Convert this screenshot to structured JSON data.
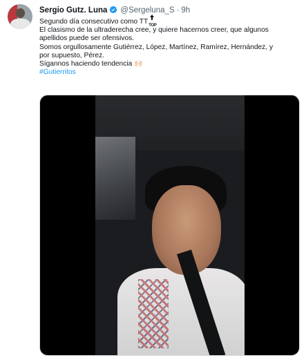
{
  "tweet": {
    "author_name": "Sergio Gutz. Luna",
    "handle": "@Sergeluna_S",
    "separator": "·",
    "time": "9h",
    "verified": true,
    "lines": [
      "Segundo día consecutivo como TT",
      "El clasismo de la ultraderecha cree, y quiere hacernos creer, que algunos",
      "apellidos puede ser ofensivos.",
      "Somos orgullosamente Gutiérrez, López, Martínez, Ramírez, Hernández, y",
      "por supuesto, Pérez.",
      "Sígannos haciendo tendencia"
    ],
    "top_badge_text": "TOP",
    "emoji": "🙌🏻",
    "hashtag": "#Gutierritos"
  },
  "colors": {
    "text": "#0f1419",
    "secondary": "#536471",
    "link": "#1d9bf0",
    "verified": "#1d9bf0"
  }
}
